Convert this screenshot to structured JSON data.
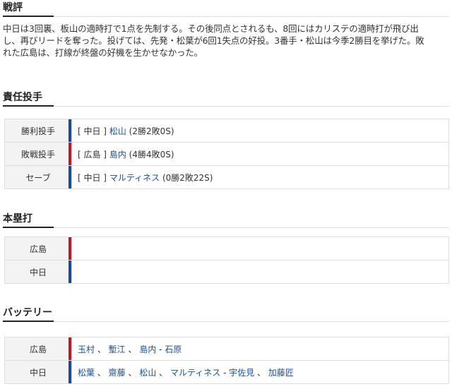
{
  "review": {
    "title": "戦評",
    "lines": [
      "中日は3回裏、板山の適時打で1点を先制する。その後同点とされるも、8回にはカリステの適時打が飛び出",
      "し、再びリードを奪った。投げては、先発・松葉が6回1失点の好投。3番手・松山は今季2勝目を挙げた。敗",
      "れた広島は、打線が終盤の好機を生かせなかった。"
    ]
  },
  "pitchers": {
    "title": "責任投手",
    "rows": [
      {
        "label": "勝利投手",
        "team": "[ 中日 ]",
        "name": "松山",
        "stats": "(2勝2敗0S)",
        "color": "blue"
      },
      {
        "label": "敗戦投手",
        "team": "[ 広島 ]",
        "name": "島内",
        "stats": "(4勝4敗0S)",
        "color": "red"
      },
      {
        "label": "セーブ",
        "team": "[ 中日 ]",
        "name": "マルティネス",
        "stats": "(0勝2敗22S)",
        "color": "blue"
      }
    ]
  },
  "homeruns": {
    "title": "本塁打",
    "rows": [
      {
        "label": "広島",
        "color": "red"
      },
      {
        "label": "中日",
        "color": "blue"
      }
    ]
  },
  "battery": {
    "title": "バッテリー",
    "rows": [
      {
        "label": "広島",
        "pitchers": [
          "玉村",
          "塹江",
          "島内"
        ],
        "catchers": [
          "石原"
        ],
        "color": "red"
      },
      {
        "label": "中日",
        "pitchers": [
          "松葉",
          "齋藤",
          "松山",
          "マルティネス"
        ],
        "catchers": [
          "宇佐見",
          "加藤匠"
        ],
        "color": "blue"
      }
    ]
  },
  "colors": {
    "red_team": "#c5152b",
    "blue_team": "#1a4a98",
    "link": "#1a4fa0"
  }
}
